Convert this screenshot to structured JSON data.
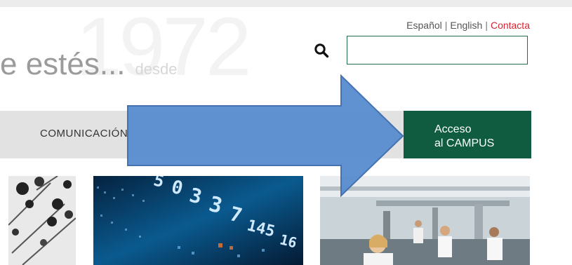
{
  "header": {
    "year_watermark": "1972",
    "tagline": "e estés...",
    "tagline_since": "desde",
    "languages": [
      "Español",
      "English"
    ],
    "contact_label": "Contacta"
  },
  "search": {
    "value": "",
    "placeholder": ""
  },
  "nav": {
    "items": [
      "COMUNICACIÓN"
    ]
  },
  "campus_button": {
    "line1": "Acceso",
    "line2": "al CAMPUS"
  },
  "thumbnails": {
    "ticker_numbers": [
      "5",
      "0",
      "3",
      "3",
      "7",
      "145",
      "16"
    ]
  },
  "colors": {
    "brand_green": "#0f5c40",
    "contact_red": "#d9232e",
    "arrow_blue": "#5b8fd1",
    "nav_gray": "#e2e2e2"
  },
  "icons": {
    "search": "search-icon",
    "arrow": "arrow-right-icon"
  }
}
